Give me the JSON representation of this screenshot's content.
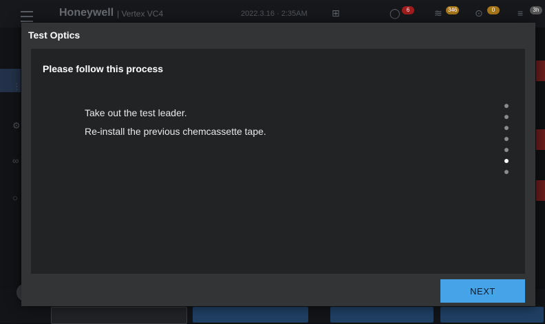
{
  "background": {
    "brand": "Honeywell",
    "product": "| Vertex VC4",
    "datetime": "2022.3.16 · 2:35AM",
    "badges": {
      "notifications": "6",
      "network": "346",
      "users": "0",
      "other": "3h"
    }
  },
  "dialog": {
    "title": "Test Optics",
    "heading": "Please follow this process",
    "steps": [
      "Take out the test leader.",
      "Re-install the previous chemcassette tape."
    ],
    "pager": {
      "total": 7,
      "current": 6
    },
    "next_label": "NEXT"
  },
  "colors": {
    "accent": "#46a3e8",
    "dialog_bg": "#333436",
    "content_bg": "#222325",
    "badge_red": "#c62828",
    "badge_orange": "#e6a11a"
  },
  "icons": [
    "menu-icon",
    "network-icon",
    "bell-icon",
    "signal-icon",
    "user-icon",
    "list-icon"
  ]
}
